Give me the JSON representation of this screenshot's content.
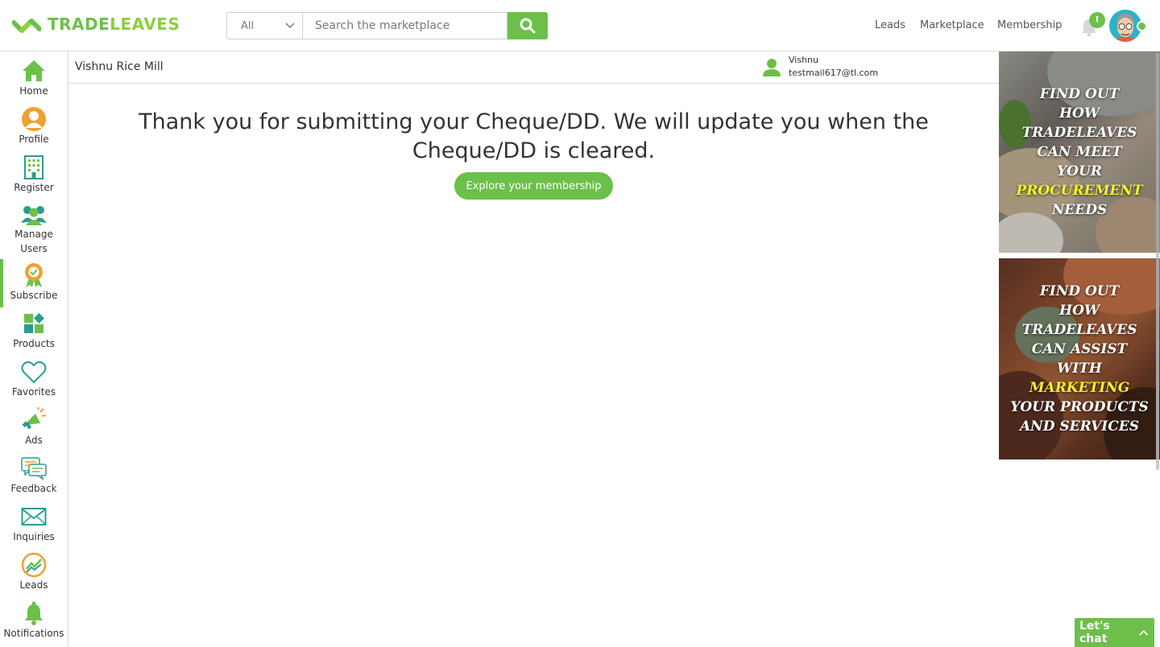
{
  "header": {
    "logo_text_a": "TRADE",
    "logo_text_b": "LEAVES",
    "search_category": "All",
    "search_placeholder": "Search the marketplace",
    "nav": [
      "Leads",
      "Marketplace",
      "Membership"
    ],
    "notification_badge": "I"
  },
  "subheader": {
    "company": "Vishnu Rice Mill",
    "user_name": "Vishnu",
    "user_email": "testmail617@tl.com"
  },
  "sidebar": {
    "items": [
      {
        "label": "Home",
        "icon": "home-icon"
      },
      {
        "label": "Profile",
        "icon": "profile-icon"
      },
      {
        "label": "Register",
        "icon": "building-icon"
      },
      {
        "label": "Manage Users",
        "icon": "users-icon"
      },
      {
        "label": "Subscribe",
        "icon": "badge-icon"
      },
      {
        "label": "Products",
        "icon": "products-icon"
      },
      {
        "label": "Favorites",
        "icon": "heart-icon"
      },
      {
        "label": "Ads",
        "icon": "megaphone-icon"
      },
      {
        "label": "Feedback",
        "icon": "feedback-icon"
      },
      {
        "label": "Inquiries",
        "icon": "mail-icon"
      },
      {
        "label": "Leads",
        "icon": "leads-icon"
      },
      {
        "label": "Notifications",
        "icon": "bell-icon"
      }
    ],
    "active": "Subscribe"
  },
  "main": {
    "message": "Thank you for submitting your Cheque/DD. We will update you when the Cheque/DD is cleared.",
    "button": "Explore your membership"
  },
  "ads": {
    "ad1": {
      "lines": [
        "FIND OUT",
        "HOW",
        "TRADELEAVES",
        "CAN MEET",
        "YOUR"
      ],
      "highlight": "PROCUREMENT",
      "tail": [
        "NEEDS"
      ]
    },
    "ad2": {
      "lines": [
        "FIND OUT",
        "HOW",
        "TRADELEAVES",
        "CAN ASSIST",
        "WITH"
      ],
      "highlight": "MARKETING",
      "tail": [
        "YOUR PRODUCTS",
        "AND SERVICES"
      ]
    }
  },
  "chat": {
    "label": "Let's chat"
  },
  "colors": {
    "brand": "#6cc04a",
    "highlight": "#f1f22a"
  }
}
